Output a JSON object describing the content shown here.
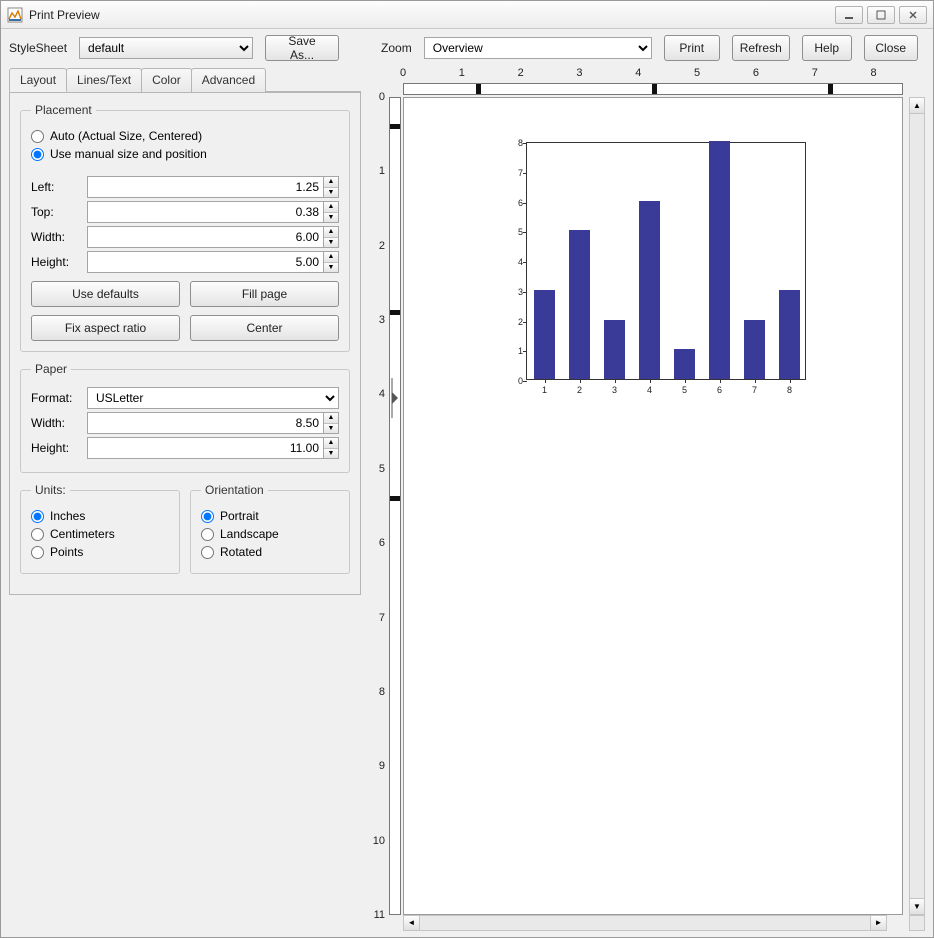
{
  "window": {
    "title": "Print Preview"
  },
  "top": {
    "stylesheet_label": "StyleSheet",
    "stylesheet_value": "default",
    "save_as": "Save As...",
    "zoom_label": "Zoom",
    "zoom_value": "Overview",
    "print": "Print",
    "refresh": "Refresh",
    "help": "Help",
    "close": "Close"
  },
  "tabs": {
    "layout": "Layout",
    "lines": "Lines/Text",
    "color": "Color",
    "advanced": "Advanced"
  },
  "placement": {
    "legend": "Placement",
    "auto": "Auto (Actual Size, Centered)",
    "manual": "Use manual size and position",
    "left_l": "Left:",
    "left_v": "1.25",
    "top_l": "Top:",
    "top_v": "0.38",
    "width_l": "Width:",
    "width_v": "6.00",
    "height_l": "Height:",
    "height_v": "5.00",
    "use_defaults": "Use defaults",
    "fill_page": "Fill page",
    "fix_aspect": "Fix aspect ratio",
    "center": "Center"
  },
  "paper": {
    "legend": "Paper",
    "format_l": "Format:",
    "format_v": "USLetter",
    "width_l": "Width:",
    "width_v": "8.50",
    "height_l": "Height:",
    "height_v": "11.00"
  },
  "units": {
    "legend": "Units:",
    "inches": "Inches",
    "cm": "Centimeters",
    "points": "Points"
  },
  "orientation": {
    "legend": "Orientation",
    "portrait": "Portrait",
    "landscape": "Landscape",
    "rotated": "Rotated"
  },
  "ruler": {
    "h_ticks": [
      "0",
      "1",
      "2",
      "3",
      "4",
      "5",
      "6",
      "7",
      "8"
    ],
    "h_markers_in": [
      1.25,
      4.25,
      7.25
    ],
    "v_ticks": [
      "0",
      "1",
      "2",
      "3",
      "4",
      "5",
      "6",
      "7",
      "8",
      "9",
      "10",
      "11"
    ],
    "v_markers_in": [
      0.38,
      2.88,
      5.38
    ],
    "paper_w_in": 8.5,
    "paper_h_in": 11.0
  },
  "chart_data": {
    "type": "bar",
    "categories": [
      "1",
      "2",
      "3",
      "4",
      "5",
      "6",
      "7",
      "8"
    ],
    "values": [
      3,
      5,
      2,
      6,
      1,
      8,
      2,
      3
    ],
    "ylim": [
      0,
      8
    ],
    "ytick": [
      0,
      1,
      2,
      3,
      4,
      5,
      6,
      7,
      8
    ],
    "title": "",
    "xlabel": "",
    "ylabel": ""
  }
}
